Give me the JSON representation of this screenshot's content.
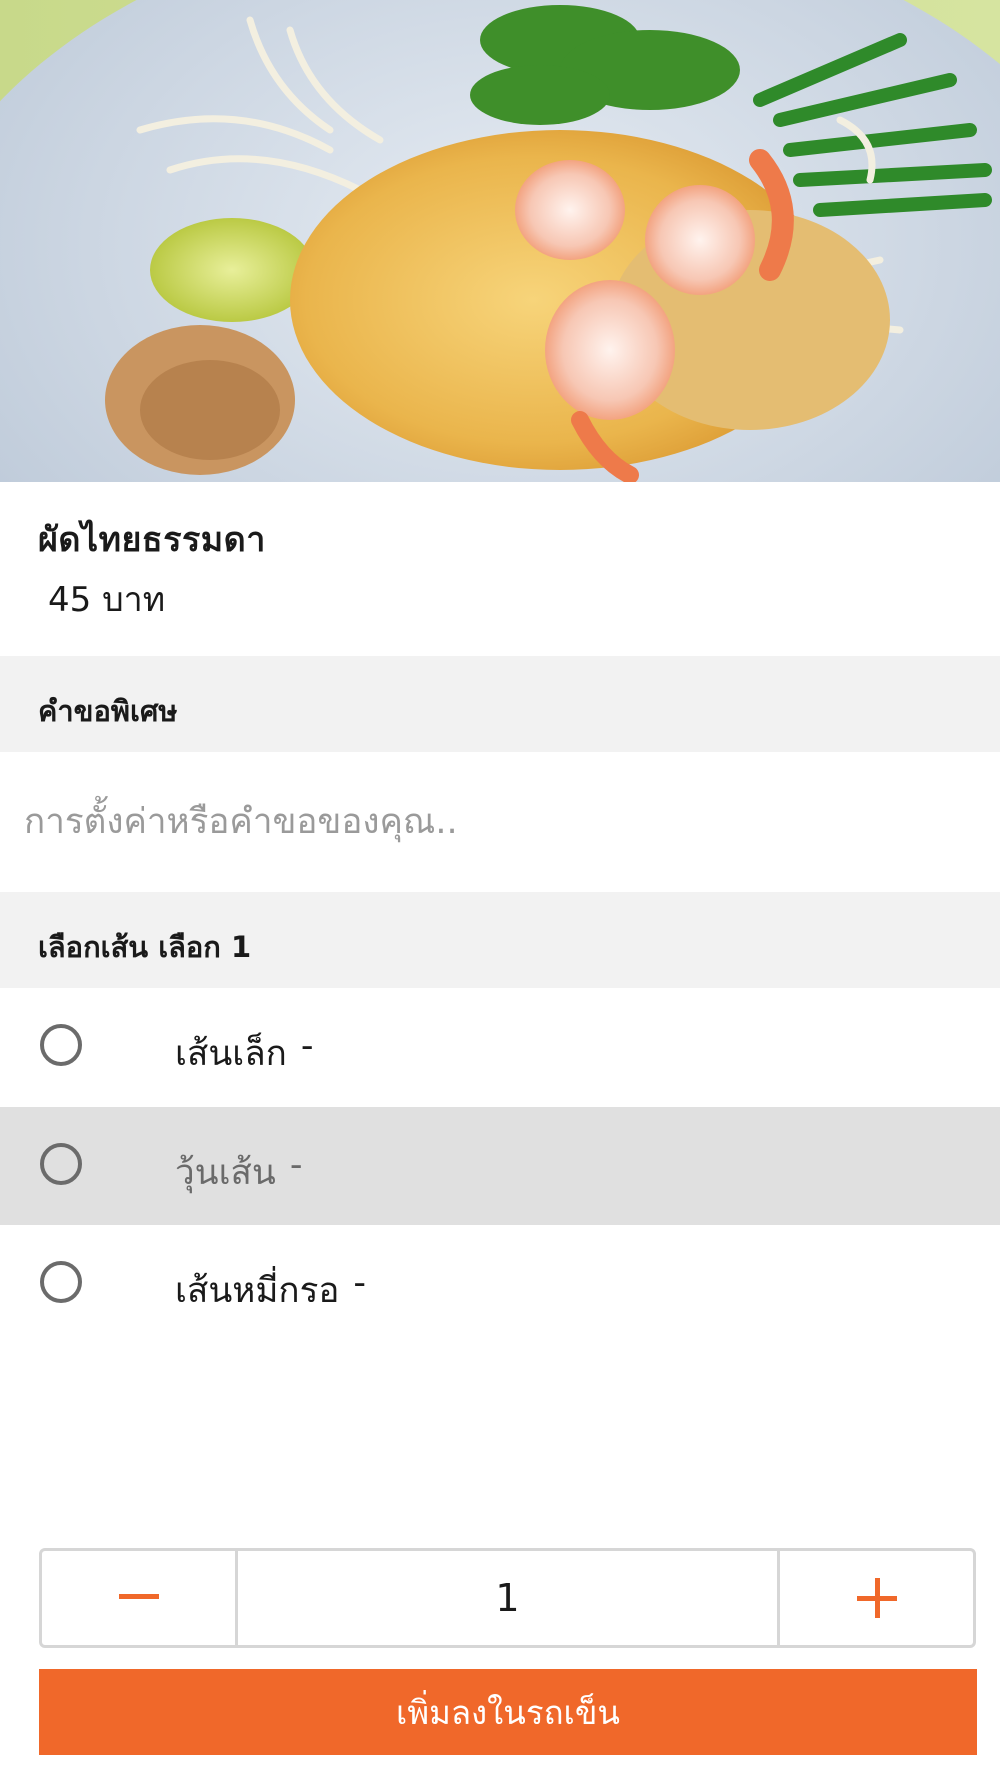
{
  "item": {
    "name": "ผัดไทยธรรมดา",
    "price": "45 บาท",
    "image_description_icon": "pad-thai-photo"
  },
  "special_request": {
    "header": "คำขอพิเศษ",
    "placeholder": "การตั้งค่าหรือคำขอของคุณ..",
    "value": ""
  },
  "noodle_choice": {
    "header": "เลือกเส้น เลือก 1",
    "options": [
      {
        "label": "เส้นเล็ก",
        "price": "-",
        "selected": false,
        "highlighted": false
      },
      {
        "label": "วุ้นเส้น",
        "price": "-",
        "selected": false,
        "highlighted": true
      },
      {
        "label": "เส้นหมี่กรอ",
        "price": "-",
        "selected": false,
        "highlighted": false
      }
    ]
  },
  "quantity": {
    "value": "1",
    "minus_icon": "minus-icon",
    "plus_icon": "plus-icon"
  },
  "cart": {
    "add_label": "เพิ่มลงในรถเข็น"
  },
  "colors": {
    "accent": "#f0682a",
    "section_bg": "#f2f2f2",
    "highlight_row": "#e0e0e0"
  }
}
